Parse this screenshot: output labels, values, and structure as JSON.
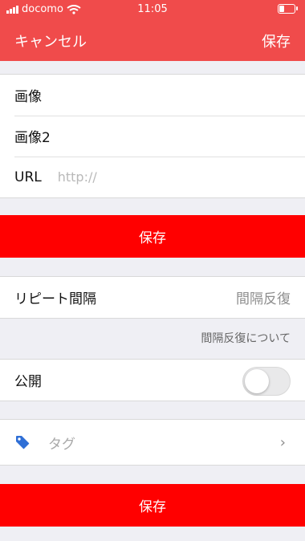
{
  "status_bar": {
    "carrier": "docomo",
    "time": "11:05"
  },
  "nav": {
    "cancel_label": "キャンセル",
    "save_label": "保存"
  },
  "form": {
    "image_label": "画像",
    "image2_label": "画像2",
    "url_label": "URL",
    "url_placeholder": "http://",
    "url_value": ""
  },
  "save_button_label": "保存",
  "repeat": {
    "label": "リピート間隔",
    "value": "間隔反復",
    "note": "間隔反復について"
  },
  "public": {
    "label": "公開",
    "enabled": false
  },
  "tag": {
    "label": "タグ"
  },
  "bottom_save_label": "保存",
  "colors": {
    "header": "#f04b4b",
    "button": "#ff0000",
    "tag_icon": "#2f6fd6"
  },
  "icons": {
    "wifi": "wifi-icon",
    "battery": "battery-icon",
    "signal": "signal-icon",
    "tag": "tag-icon",
    "chevron": "chevron-right-icon"
  }
}
